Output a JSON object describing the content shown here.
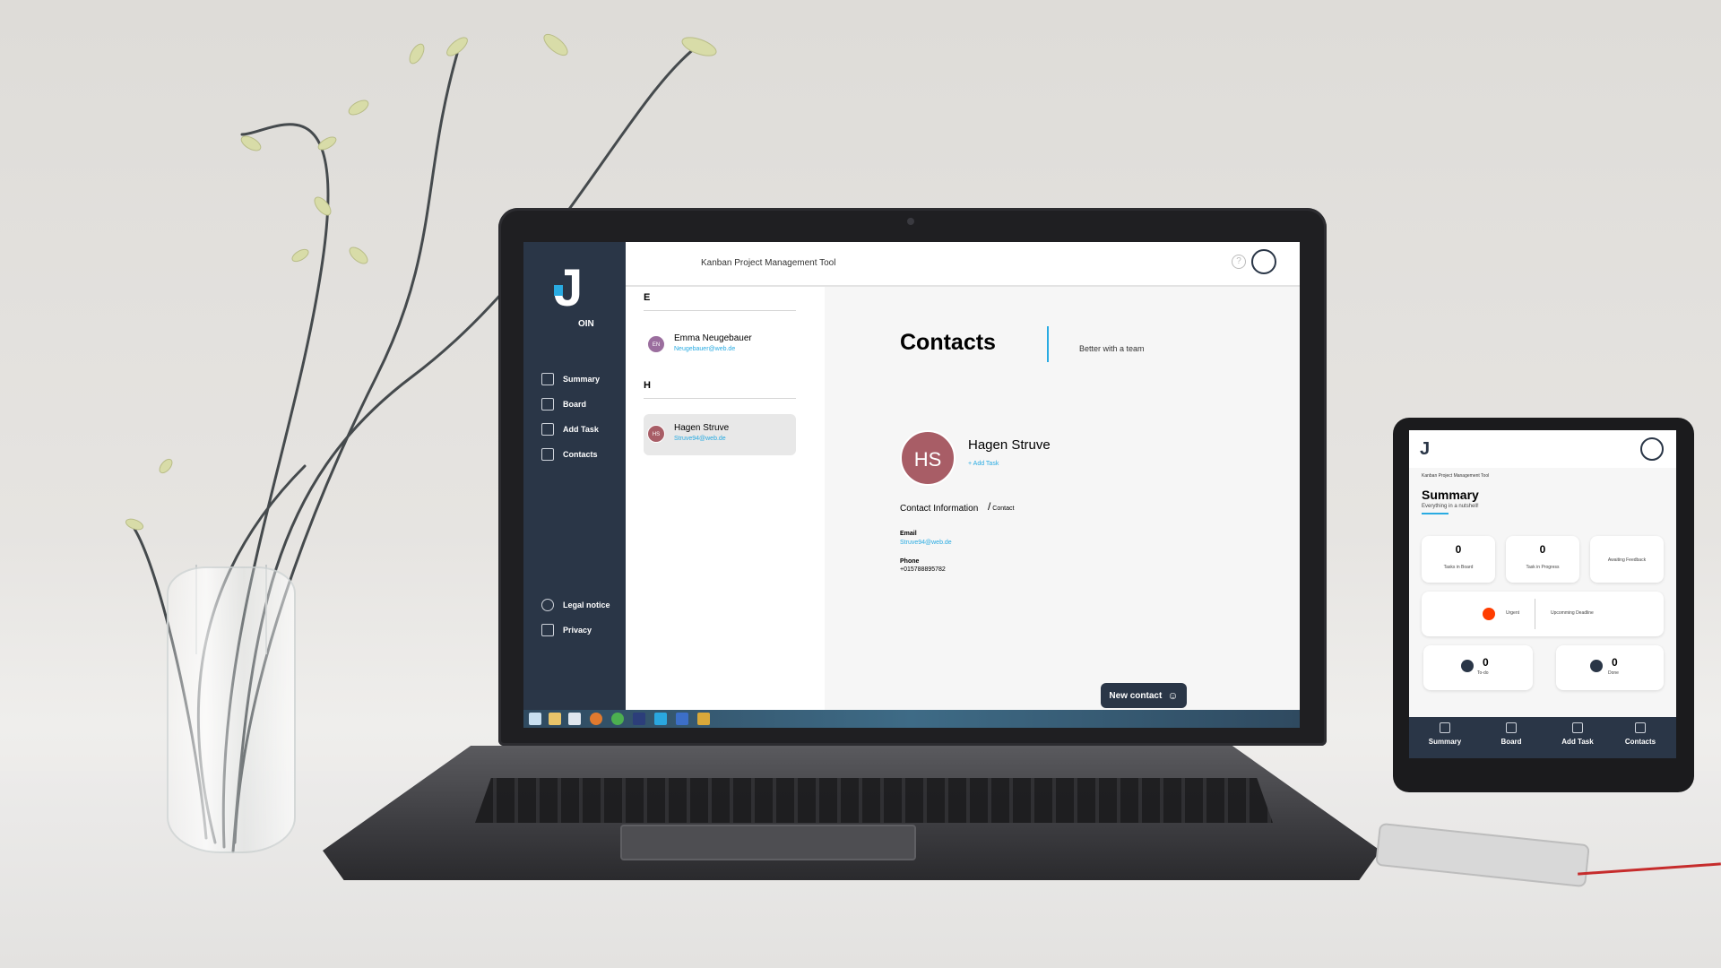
{
  "app": {
    "title": "Kanban Project Management Tool",
    "logo_suffix": "OIN",
    "logo_letter": "J",
    "help_icon_text": "?"
  },
  "sidebar": {
    "items": [
      {
        "label": "Summary",
        "icon": "summary-icon"
      },
      {
        "label": "Board",
        "icon": "board-icon"
      },
      {
        "label": "Add Task",
        "icon": "add-task-icon"
      },
      {
        "label": "Contacts",
        "icon": "contacts-icon"
      }
    ],
    "footer": [
      {
        "label": "Legal notice",
        "icon": "info-icon"
      },
      {
        "label": "Privacy",
        "icon": "bookmark-icon"
      }
    ]
  },
  "contact_list": {
    "groups": [
      {
        "letter": "E",
        "contacts": [
          {
            "initials": "EN",
            "name": "Emma Neugebauer",
            "email": "Neugebauer@web.de",
            "color": "#9b6e9e",
            "selected": false
          }
        ]
      },
      {
        "letter": "H",
        "contacts": [
          {
            "initials": "HS",
            "name": "Hagen Struve",
            "email": "Struve94@web.de",
            "color": "#a85d66",
            "selected": true
          }
        ]
      }
    ]
  },
  "detail": {
    "heading": "Contacts",
    "subheading": "Better with a team",
    "initials": "HS",
    "name": "Hagen Struve",
    "add_task": "Add Task",
    "info_title": "Contact Information",
    "edit_label": "Contact",
    "email_label": "Email",
    "email": "Struve94@web.de",
    "phone_label": "Phone",
    "phone": "+015788895782",
    "new_contact_label": "New contact"
  },
  "tablet": {
    "app_title": "Kanban Project Management Tool",
    "title": "Summary",
    "subtitle": "Everything in a nutshell!",
    "cards": [
      {
        "value": "0",
        "label": "Tasks in Board"
      },
      {
        "value": "0",
        "label": "Task in Progress"
      },
      {
        "value": "",
        "label": "Awaiting Feedback"
      }
    ],
    "urgent_label": "Urgent",
    "deadline_label": "Upcomming Deadline",
    "todo": {
      "value": "0",
      "label": "To-do"
    },
    "done": {
      "value": "0",
      "label": "Done"
    },
    "nav": [
      "Summary",
      "Board",
      "Add Task",
      "Contacts"
    ]
  },
  "colors": {
    "sidebar": "#2a3647",
    "accent": "#29abe2",
    "urgent": "#ff3d00"
  }
}
